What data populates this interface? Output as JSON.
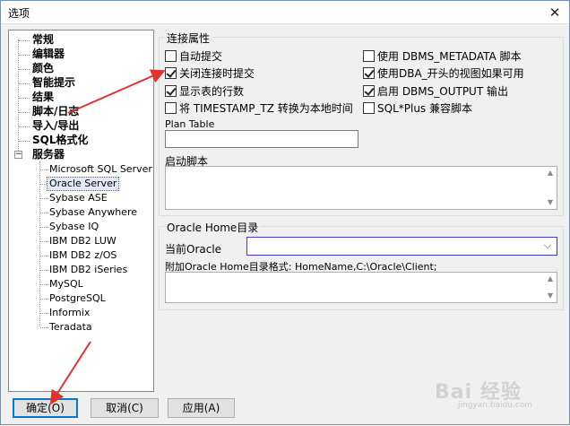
{
  "window": {
    "title": "选项",
    "close_glyph": "✕"
  },
  "tree": {
    "items": [
      "常规",
      "编辑器",
      "颜色",
      "智能提示",
      "结果",
      "脚本/日志",
      "导入/导出",
      "SQL格式化",
      "服务器"
    ],
    "expander_glyph": "−",
    "servers": [
      "Microsoft SQL Server",
      "Oracle Server",
      "Sybase ASE",
      "Sybase Anywhere",
      "Sybase IQ",
      "IBM DB2 LUW",
      "IBM DB2 z/OS",
      "IBM DB2 iSeries",
      "MySQL",
      "PostgreSQL",
      "Informix",
      "Teradata"
    ],
    "selected": "Oracle Server"
  },
  "connection": {
    "title": "连接属性",
    "left_options": [
      {
        "label": "自动提交",
        "checked": false
      },
      {
        "label": "关闭连接时提交",
        "checked": true
      },
      {
        "label": "显示表的行数",
        "checked": true
      },
      {
        "label": "将 TIMESTAMP_TZ 转换为本地时间",
        "checked": false
      }
    ],
    "right_options": [
      {
        "label": "使用 DBMS_METADATA 脚本",
        "checked": false
      },
      {
        "label": "使用DBA_开头的视图如果可用",
        "checked": true
      },
      {
        "label": "启用 DBMS_OUTPUT 输出",
        "checked": true
      },
      {
        "label": "SQL*Plus 兼容脚本",
        "checked": false
      }
    ],
    "plan_table_label": "Plan Table",
    "plan_table_value": "",
    "startup_script_label": "启动脚本",
    "startup_script_value": ""
  },
  "oracle_home": {
    "title": "Oracle Home目录",
    "current_label": "当前Oracle",
    "current_value": "",
    "additional_label": "附加Oracle Home目录格式: HomeName,C:\\Oracle\\Client;",
    "additional_value": ""
  },
  "buttons": {
    "ok": "确定(O)",
    "cancel": "取消(C)",
    "apply": "应用(A)"
  },
  "icons": {
    "close": "close-icon",
    "dropdown": "chevron-down-icon",
    "scroll_up": "scroll-up-icon",
    "scroll_down": "scroll-down-icon"
  },
  "colors": {
    "annotation_arrow": "#e0322b",
    "focus_border": "#3c3cd8",
    "default_button_border": "#0078d7"
  },
  "watermark": {
    "text": "Bai 经验",
    "sub": "jingyan.baidu.com"
  }
}
